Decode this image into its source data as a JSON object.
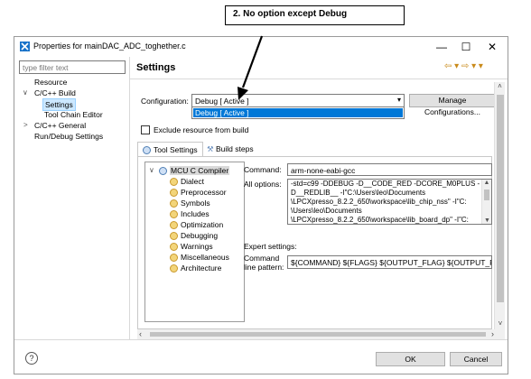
{
  "annotation": {
    "text": "2. No option except Debug"
  },
  "window": {
    "title": "Properties for mainDAC_ADC_toghether.c",
    "minimize_symbol": "—",
    "maximize_symbol": "☐",
    "close_symbol": "✕"
  },
  "left_pane": {
    "filter_placeholder": "type filter text",
    "tree": [
      {
        "label": "Resource"
      },
      {
        "label": "C/C++ Build",
        "chevron": "∨"
      },
      {
        "label": "Settings"
      },
      {
        "label": "Tool Chain Editor"
      },
      {
        "label": "C/C++ General",
        "chevron": ">"
      },
      {
        "label": "Run/Debug Settings"
      }
    ]
  },
  "settings": {
    "title": "Settings",
    "nav_arrows": "⇦ ▾ ⇨ ▾ ▾",
    "configuration_label": "Configuration:",
    "configuration_value": "Debug  [ Active ]",
    "dropdown_option": "Debug  [ Active ]",
    "manage_button": "Manage Configurations...",
    "exclude_label": "Exclude resource from build",
    "tabs": [
      "Tool Settings",
      "Build steps"
    ]
  },
  "tool_tree": {
    "root": "MCU C Compiler",
    "root_chevron": "∨",
    "items": [
      "Dialect",
      "Preprocessor",
      "Symbols",
      "Includes",
      "Optimization",
      "Debugging",
      "Warnings",
      "Miscellaneous",
      "Architecture"
    ]
  },
  "command": {
    "label": "Command:",
    "value": "arm-none-eabi-gcc"
  },
  "all_options": {
    "label": "All options:",
    "lines": [
      "-std=c99 -DDEBUG -D__CODE_RED -DCORE_M0PLUS -",
      "D__REDLIB__ -I\"C:\\Users\\leo\\Documents",
      "\\LPCXpresso_8.2.2_650\\workspace\\lib_chip_nss\" -I\"C:",
      "\\Users\\leo\\Documents",
      "\\LPCXpresso_8.2.2_650\\workspace\\lib_board_dp\" -I\"C:"
    ]
  },
  "expert": {
    "label": "Expert settings:",
    "pattern_label_1": "Command",
    "pattern_label_2": "line pattern:",
    "pattern_value": "${COMMAND} ${FLAGS} ${OUTPUT_FLAG} ${OUTPUT_PREFIX}"
  },
  "footer": {
    "help_symbol": "?",
    "ok": "OK",
    "cancel": "Cancel"
  },
  "colors": {
    "selection": "#0078d7",
    "tree_selection": "#cce8ff",
    "title_icon": "#1a73c9"
  }
}
